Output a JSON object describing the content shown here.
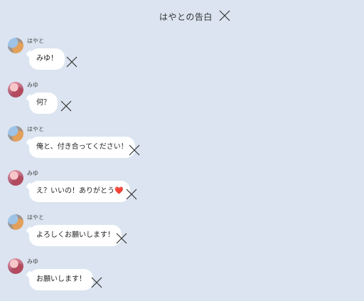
{
  "header": {
    "title": "はやとの告白"
  },
  "messages": [
    {
      "sender": "はやと",
      "text": "みゆ！",
      "avatar": "hayato"
    },
    {
      "sender": "みゆ",
      "text": "何？",
      "avatar": "miyu"
    },
    {
      "sender": "はやと",
      "text": "俺と、付き合ってください！",
      "avatar": "hayato"
    },
    {
      "sender": "みゆ",
      "text": "え？いいの！ありがとう",
      "emoji": "❤️",
      "avatar": "miyu"
    },
    {
      "sender": "はやと",
      "text": "よろしくお願いします！",
      "avatar": "hayato"
    },
    {
      "sender": "みゆ",
      "text": "お願いします！",
      "avatar": "miyu"
    }
  ],
  "colors": {
    "background": "#dbe4f0",
    "bubble": "#ffffff",
    "text": "#222222"
  }
}
